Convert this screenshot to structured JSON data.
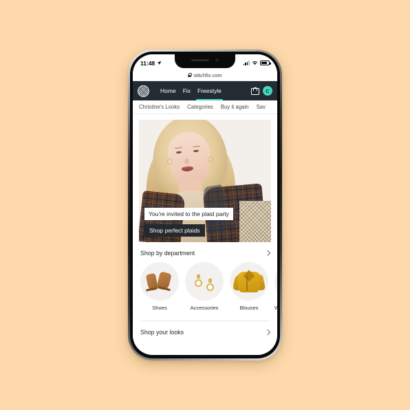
{
  "page": {
    "background_color": "#fdd9ab"
  },
  "device": {
    "type": "iphone",
    "frame_color": "#1c1c1c"
  },
  "status_bar": {
    "time": "11:48",
    "location_icon": "location-arrow-icon",
    "signal_icon": "cellular-signal-icon",
    "wifi_icon": "wifi-icon",
    "battery_icon": "battery-icon"
  },
  "browser": {
    "lock_icon": "lock-icon",
    "url": "stitchfix.com"
  },
  "top_nav": {
    "logo_name": "stitch-fix-logo",
    "links": [
      {
        "label": "Home",
        "active": false
      },
      {
        "label": "Fix",
        "active": false
      },
      {
        "label": "Freestyle",
        "active": true
      }
    ],
    "bag_icon": "shopping-bag-icon",
    "avatar_initial": "C",
    "accent_color": "#45d6c0",
    "background_color": "#232b33"
  },
  "sub_nav": {
    "items": [
      "Christine's Looks",
      "Categories",
      "Buy it again",
      "Sav"
    ]
  },
  "hero": {
    "headline": "You're invited to the plaid party",
    "cta": "Shop perfect plaids",
    "image_description": "model-in-plaid-blazer"
  },
  "shop_by_department": {
    "title": "Shop by department",
    "chevron_icon": "chevron-right-icon",
    "items": [
      {
        "label": "Shoes",
        "icon": "ankle-boots-icon"
      },
      {
        "label": "Accessories",
        "icon": "hoop-earrings-icon"
      },
      {
        "label": "Blouses",
        "icon": "yellow-blouse-icon"
      },
      {
        "label": "W",
        "icon": "partial-category-icon"
      }
    ]
  },
  "shop_your_looks": {
    "title": "Shop your looks",
    "chevron_icon": "chevron-right-icon"
  }
}
